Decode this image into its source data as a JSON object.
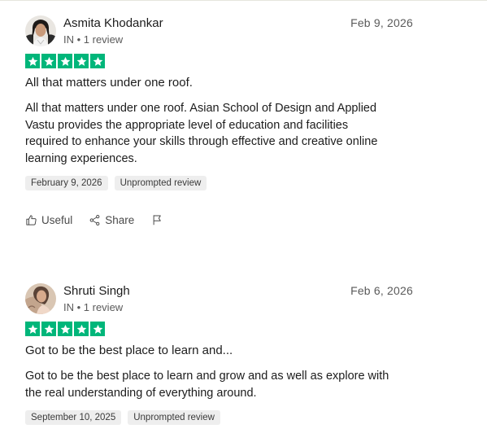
{
  "reviews": [
    {
      "name": "Asmita Khodankar",
      "meta": "IN • 1 review",
      "date": "Feb 9, 2026",
      "rating": 5,
      "title": "All that matters under one roof.",
      "body_lines": [
        "All that matters under one roof. Asian School of Design and Applied",
        "Vastu provides the appropriate level of education and facilities",
        "required to enhance your skills through effective and creative online",
        "learning experiences."
      ],
      "tags": [
        "February 9, 2026",
        "Unprompted review"
      ],
      "actions": {
        "useful": "Useful",
        "share": "Share"
      },
      "icons": [
        "thumbs-up-icon",
        "share-icon",
        "flag-icon"
      ]
    },
    {
      "name": "Shruti Singh",
      "meta": "IN • 1 review",
      "date": "Feb 6, 2026",
      "rating": 5,
      "title": "Got to be the best place to learn and...",
      "body_lines": [
        "Got to be the best place to learn and grow and as well as explore with",
        "the real understanding of everything around."
      ],
      "tags": [
        "September 10, 2025",
        "Unprompted review"
      ]
    }
  ],
  "colors": {
    "star_green": "#00b67a",
    "tag_bg": "#eeeeee",
    "muted_text": "#5a5a5a"
  }
}
